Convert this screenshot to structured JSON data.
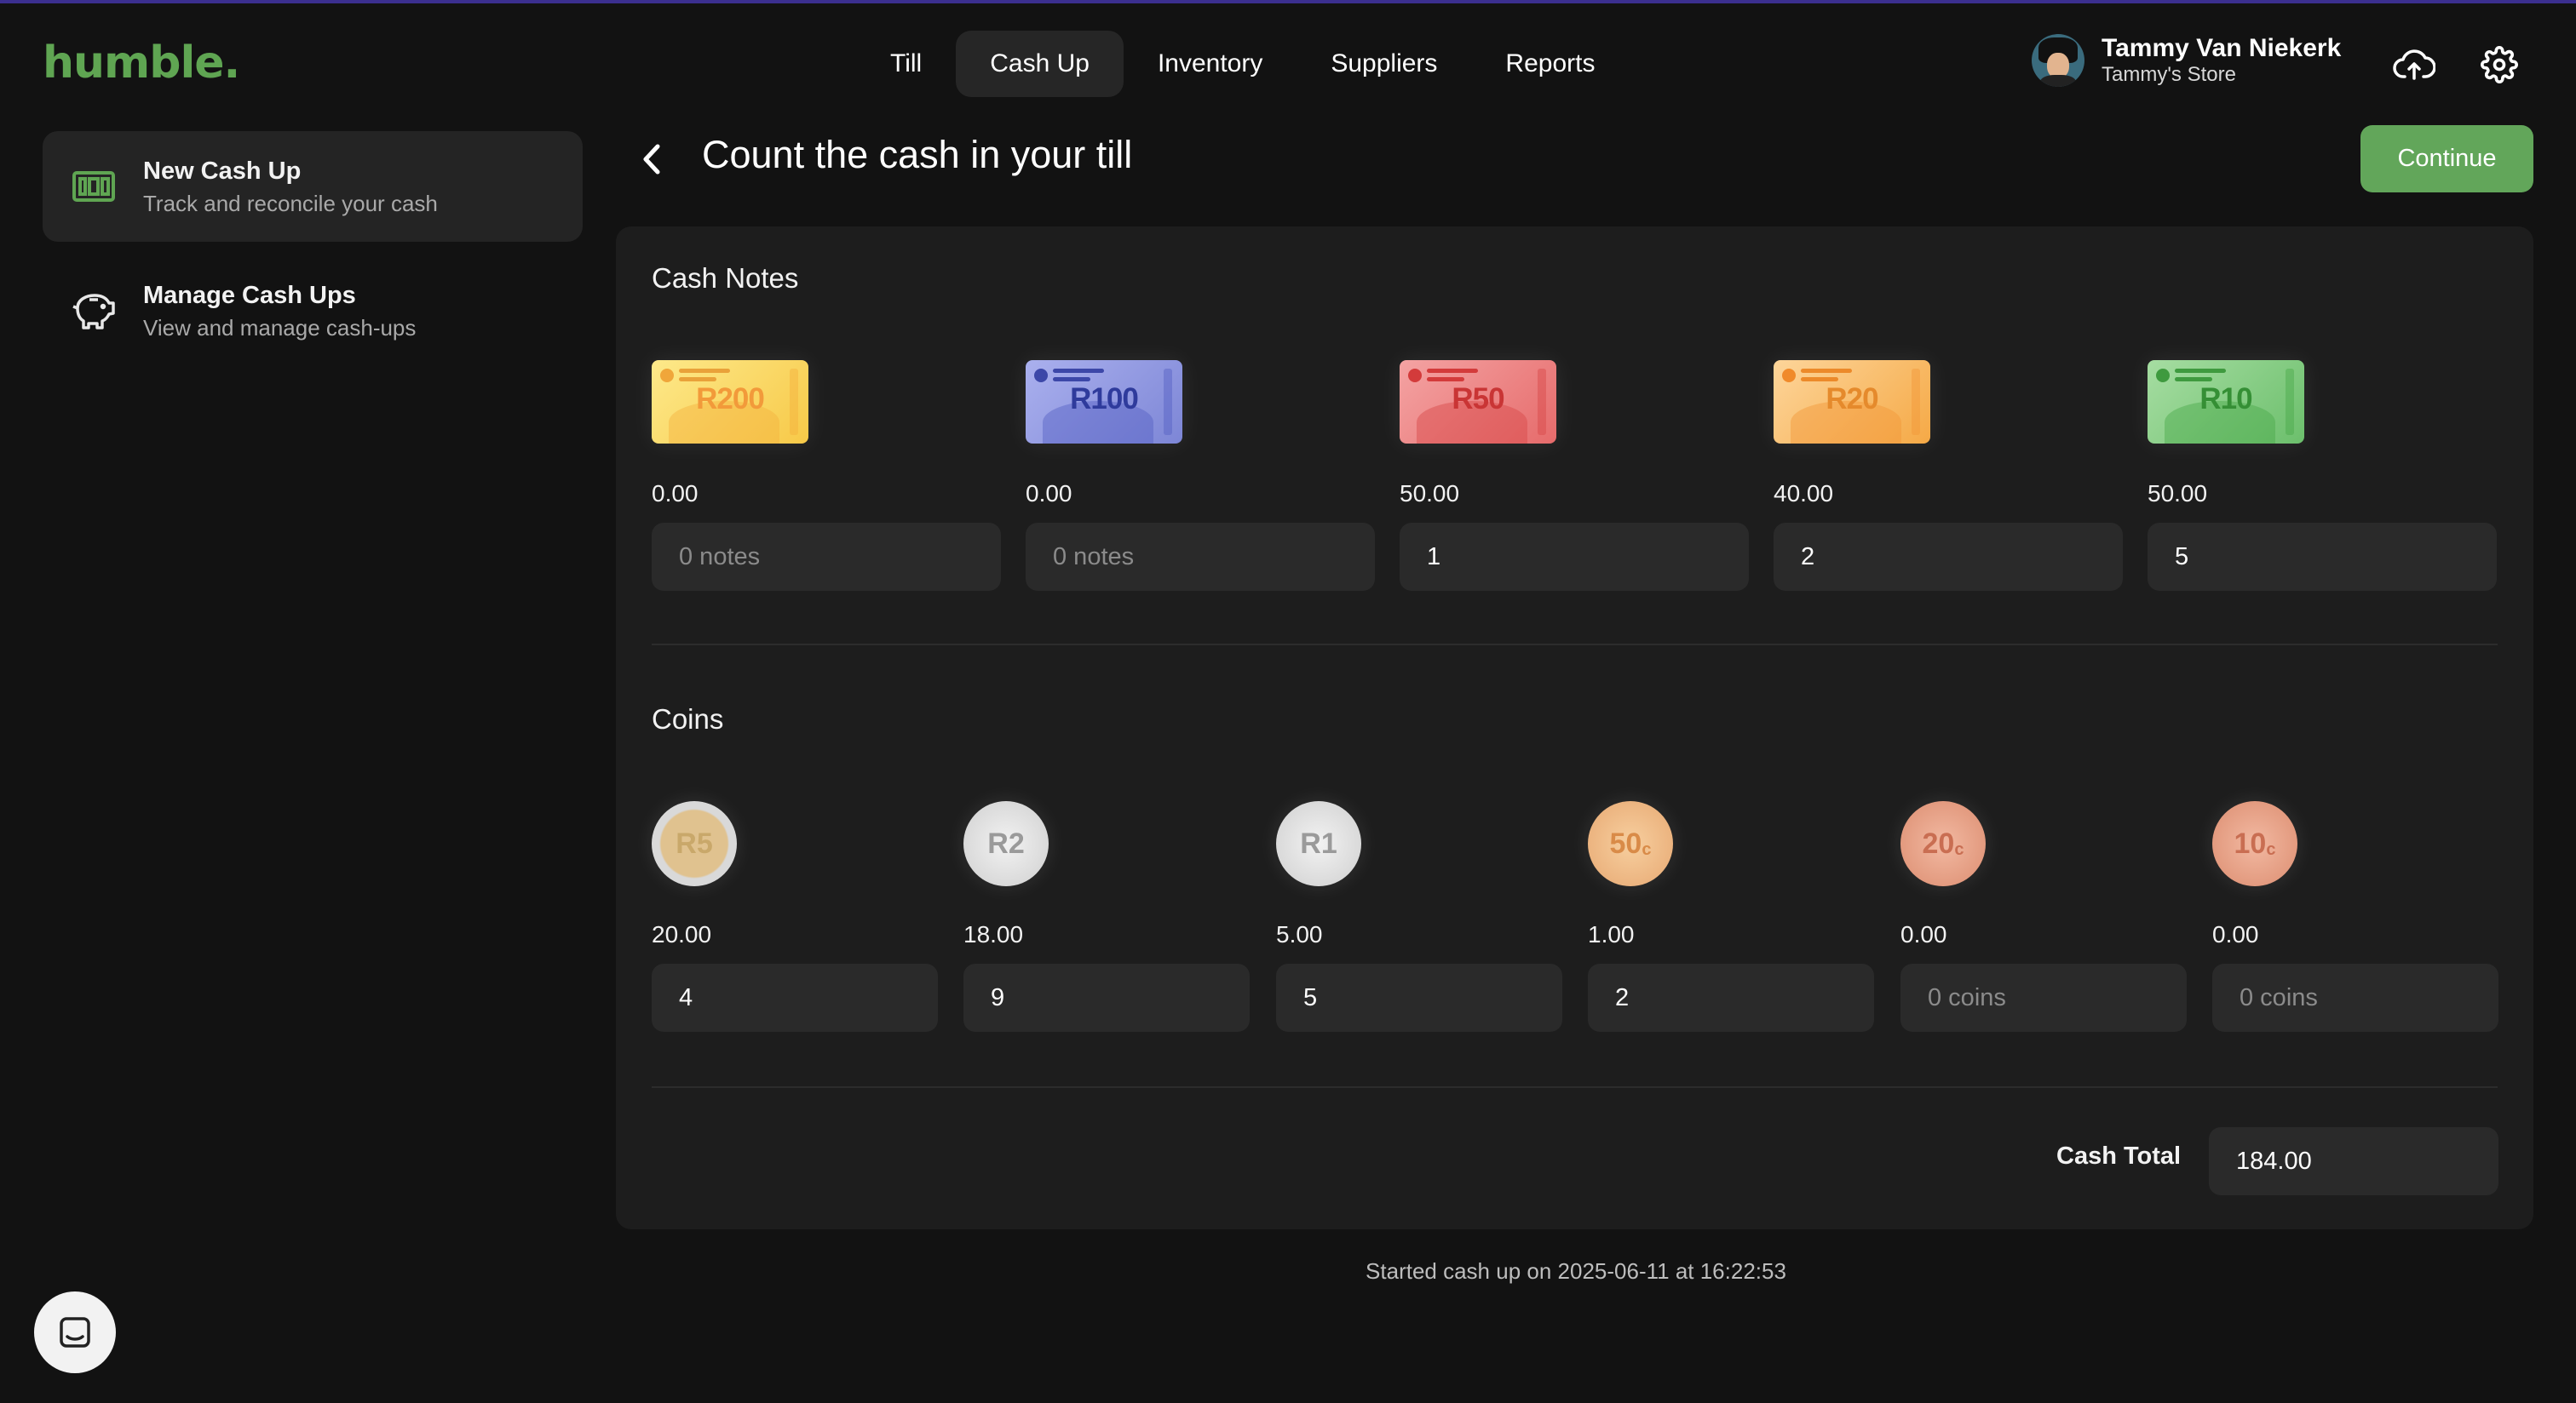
{
  "brand": {
    "logo_text": "humble."
  },
  "nav": {
    "items": [
      {
        "label": "Till"
      },
      {
        "label": "Cash Up"
      },
      {
        "label": "Inventory"
      },
      {
        "label": "Suppliers"
      },
      {
        "label": "Reports"
      }
    ],
    "active": "Cash Up"
  },
  "user": {
    "name": "Tammy Van Niekerk",
    "store": "Tammy's Store"
  },
  "toolbar": {
    "cloud_icon": "cloud-upload-icon",
    "settings_icon": "gear-icon"
  },
  "sidebar": {
    "items": [
      {
        "title": "New Cash Up",
        "subtitle": "Track and reconcile your cash",
        "icon": "cash-note-icon"
      },
      {
        "title": "Manage Cash Ups",
        "subtitle": "View and manage cash-ups",
        "icon": "piggy-bank-icon"
      }
    ]
  },
  "header": {
    "title": "Count the cash in your till",
    "continue_label": "Continue"
  },
  "cash_notes": {
    "title": "Cash Notes",
    "items": [
      {
        "label": "R200",
        "amount": "0.00",
        "value": "",
        "placeholder": "0 notes",
        "color": "#f7c948"
      },
      {
        "label": "R100",
        "amount": "0.00",
        "value": "",
        "placeholder": "0 notes",
        "color": "#7d86d6"
      },
      {
        "label": "R50",
        "amount": "50.00",
        "value": "1",
        "placeholder": "0 notes",
        "color": "#e66b6b"
      },
      {
        "label": "R20",
        "amount": "40.00",
        "value": "2",
        "placeholder": "0 notes",
        "color": "#f5a946"
      },
      {
        "label": "R10",
        "amount": "50.00",
        "value": "5",
        "placeholder": "0 notes",
        "color": "#6cbf6c"
      }
    ]
  },
  "coins": {
    "title": "Coins",
    "items": [
      {
        "label": "R5",
        "sub": "",
        "amount": "20.00",
        "value": "4",
        "placeholder": "0 coins"
      },
      {
        "label": "R2",
        "sub": "",
        "amount": "18.00",
        "value": "9",
        "placeholder": "0 coins"
      },
      {
        "label": "R1",
        "sub": "",
        "amount": "5.00",
        "value": "5",
        "placeholder": "0 coins"
      },
      {
        "label": "50",
        "sub": "c",
        "amount": "1.00",
        "value": "2",
        "placeholder": "0 coins"
      },
      {
        "label": "20",
        "sub": "c",
        "amount": "0.00",
        "value": "",
        "placeholder": "0 coins"
      },
      {
        "label": "10",
        "sub": "c",
        "amount": "0.00",
        "value": "",
        "placeholder": "0 coins"
      }
    ]
  },
  "total": {
    "label": "Cash Total",
    "value": "184.00"
  },
  "footer": {
    "started": "Started cash up on 2025-06-11 at 16:22:53"
  }
}
